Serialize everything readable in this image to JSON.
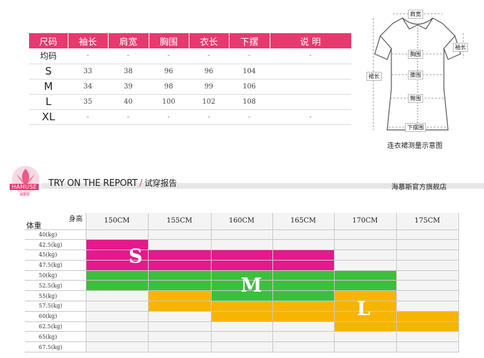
{
  "size_table": {
    "headers": [
      "尺码",
      "袖长",
      "肩宽",
      "胸围",
      "衣长",
      "下摆",
      "说 明"
    ],
    "rows": [
      {
        "size": "均码",
        "values": [
          "-",
          "-",
          "-",
          "-",
          "-",
          "-"
        ]
      },
      {
        "size": "S",
        "values": [
          "33",
          "38",
          "96",
          "96",
          "104",
          ""
        ]
      },
      {
        "size": "M",
        "values": [
          "34",
          "39",
          "98",
          "99",
          "106",
          ""
        ]
      },
      {
        "size": "L",
        "values": [
          "35",
          "40",
          "100",
          "102",
          "108",
          ""
        ]
      },
      {
        "size": "XL",
        "values": [
          "-",
          "-",
          "-",
          "-",
          "-",
          "-"
        ]
      }
    ]
  },
  "diagram": {
    "labels": {
      "shoulder": "肩宽",
      "sleeve": "袖长",
      "chest": "胸围",
      "waist": "腰围",
      "hip": "臀围",
      "length": "裙长",
      "hem": "下摆围"
    },
    "caption": "连衣裙测量示意图"
  },
  "banner": {
    "logo_text": "HAMUSE",
    "logo_sub": "海慕斯",
    "title_en": "TRY ON THE REPORT",
    "slash": "/",
    "title_cn": "试穿报告",
    "shop": "海慕斯官方旗舰店"
  },
  "tryon": {
    "corner_height": "身高",
    "corner_weight": "体重",
    "heights": [
      "150CM",
      "155CM",
      "160CM",
      "165CM",
      "170CM",
      "175CM"
    ],
    "weights": [
      "40(kg)",
      "42.5(kg)",
      "45(kg)",
      "47.5(kg)",
      "50(kg)",
      "52.5(kg)",
      "55(kg)",
      "57.5(kg)",
      "60(kg)",
      "62.5(kg)",
      "65(kg)",
      "67.5(kg)"
    ],
    "grid": [
      [
        "",
        "",
        "",
        "",
        "",
        ""
      ],
      [
        "S",
        "",
        "",
        "",
        "",
        ""
      ],
      [
        "S",
        "S",
        "S",
        "S",
        "",
        ""
      ],
      [
        "S",
        "S",
        "S",
        "S",
        "",
        ""
      ],
      [
        "M",
        "M",
        "M",
        "M",
        "M",
        ""
      ],
      [
        "M",
        "M",
        "M",
        "M",
        "M",
        ""
      ],
      [
        "",
        "L",
        "M",
        "M",
        "L",
        ""
      ],
      [
        "",
        "L",
        "L",
        "L",
        "L",
        ""
      ],
      [
        "",
        "",
        "L",
        "L",
        "L",
        "L"
      ],
      [
        "",
        "",
        "",
        "",
        "L",
        "L"
      ],
      [
        "",
        "",
        "",
        "",
        "",
        ""
      ],
      [
        "",
        "",
        "",
        "",
        "",
        ""
      ]
    ],
    "letters": {
      "s": "S",
      "m": "M",
      "l": "L"
    },
    "colors": {
      "S": "#e5198c",
      "M": "#3cbf3c",
      "L": "#f7b500",
      "header": "#e8396e"
    }
  }
}
